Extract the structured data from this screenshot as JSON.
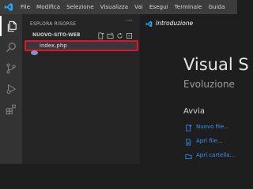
{
  "menu": {
    "items": [
      "File",
      "Modifica",
      "Selezione",
      "Visualizza",
      "Vai",
      "Esegui",
      "Terminale",
      "Guida"
    ]
  },
  "activity_bar": {
    "icons": [
      "explorer-icon",
      "search-icon",
      "source-control-icon",
      "run-debug-icon",
      "extensions-icon"
    ],
    "active": "explorer-icon"
  },
  "sidebar": {
    "title": "ESPLORA RISORSE",
    "more": "···",
    "folder": "NUOVO-SITO-WEB",
    "folder_actions": [
      "new-file-icon",
      "new-folder-icon",
      "refresh-icon",
      "collapse-all-icon"
    ],
    "files": [
      {
        "name": "index.php",
        "icon": "php-file-icon",
        "selected": true
      }
    ]
  },
  "editor": {
    "tab": {
      "label": "Introduzione",
      "icon": "vscode-welcome-icon"
    },
    "welcome": {
      "title": "Visual S",
      "subtitle": "Evoluzione",
      "start_heading": "Avvia",
      "links": [
        {
          "label": "Nuovo file...",
          "icon": "new-file-icon"
        },
        {
          "label": "Apri file...",
          "icon": "open-file-icon"
        },
        {
          "label": "Apri cartella...",
          "icon": "open-folder-icon"
        }
      ]
    }
  },
  "colors": {
    "accent": "#3794ff",
    "highlight_border": "#e81123",
    "vscode_blue": "#23a9f2"
  }
}
